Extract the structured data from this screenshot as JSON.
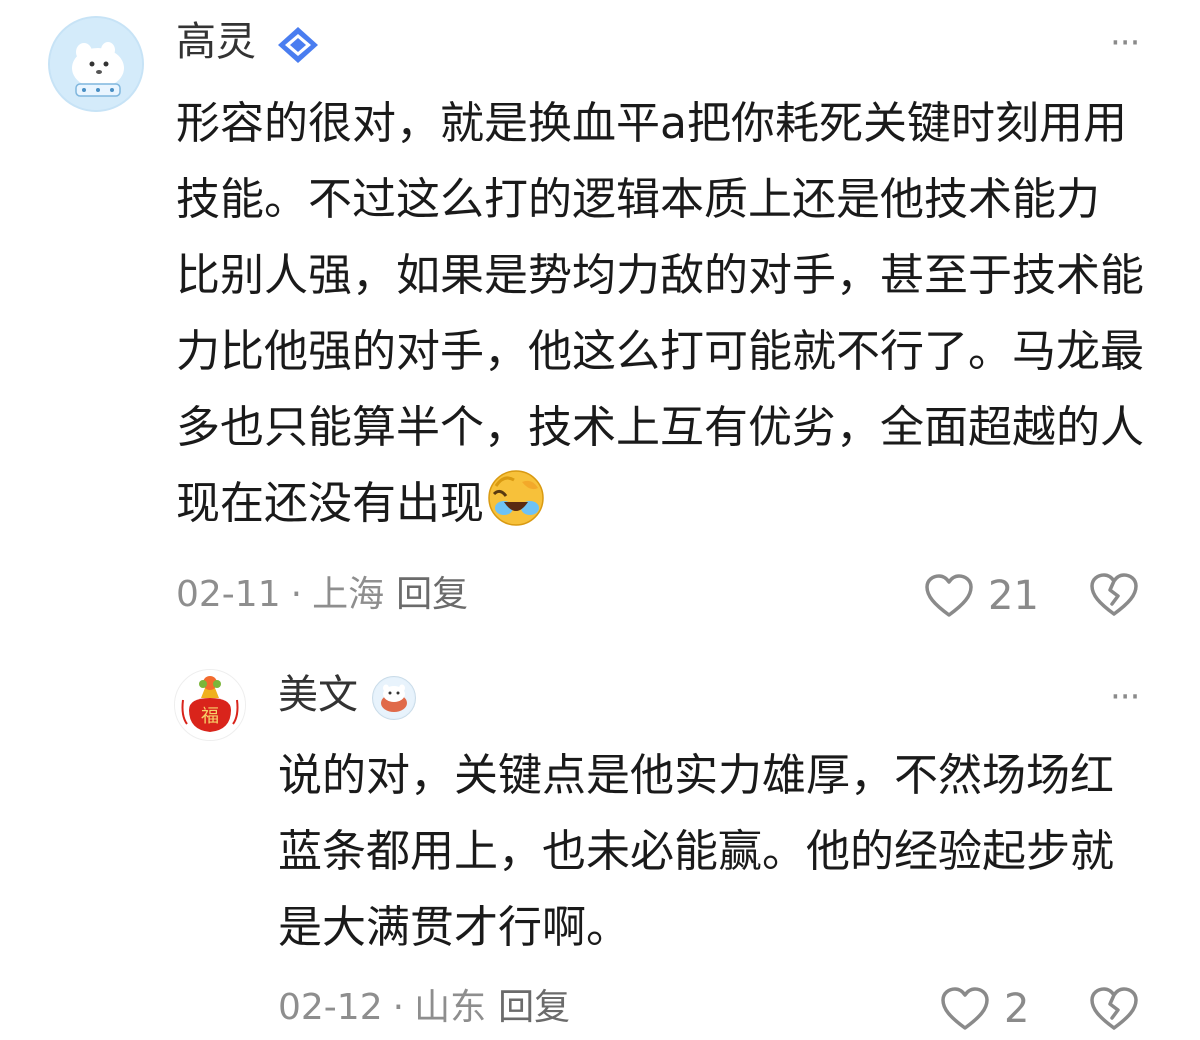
{
  "comments": [
    {
      "author": "高灵",
      "avatar_icon": "polar-bear-avatar-icon",
      "badge_icon": "verified-diamond-icon",
      "more_label": "···",
      "lines": [
        "形容的很对，就是换血平a把你耗死关键时刻用用",
        "技能。不过这么打的逻辑本质上还是他技术能力",
        "比别人强，如果是势均力敌的对手，甚至于技术能",
        "力比他强的对手，他这么打可能就不行了。马龙最",
        "多也只能算半个，技术上互有优劣，全面超越的人",
        "现在还没有出现"
      ],
      "emoji_icon": "laughing-crying-emoji-icon",
      "date": "02-11",
      "separator": "·",
      "location": "上海",
      "reply_label": "回复",
      "likes": "21"
    },
    {
      "author": "美文",
      "avatar_icon": "fortune-bag-avatar-icon",
      "badge_icon": "bear-badge-icon",
      "more_label": "···",
      "lines": [
        "说的对，关键点是他实力雄厚，不然场场红",
        "蓝条都用上，也未必能赢。他的经验起步就",
        "是大满贯才行啊。"
      ],
      "date": "02-12",
      "separator": "·",
      "location": "山东",
      "reply_label": "回复",
      "likes": "2"
    }
  ],
  "avatar2_text": "福",
  "colors": {
    "text": "#1a1a1a",
    "name": "#333333",
    "meta": "#8e8e8e",
    "verified": "#4a7df0",
    "emoji": "#f7c13a"
  }
}
